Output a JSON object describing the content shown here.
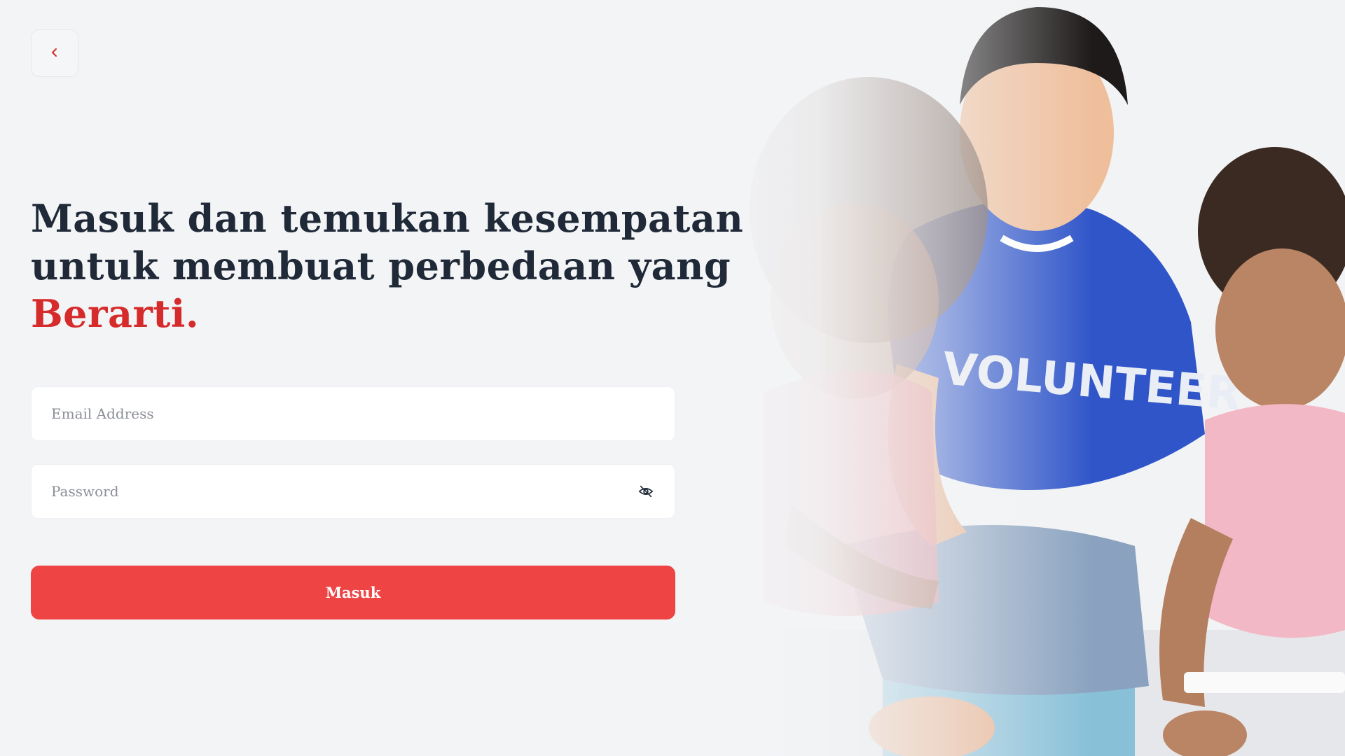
{
  "headline": {
    "line1": "Masuk dan temukan kesempatan",
    "line2": "untuk membuat perbedaan yang",
    "accent": "Berarti."
  },
  "form": {
    "email_placeholder": "Email Address",
    "password_placeholder": "Password",
    "submit_label": "Masuk"
  },
  "hero": {
    "shirt_text": "VOLUNTEER"
  },
  "icons": {
    "back": "chevron-left-icon",
    "password_toggle": "eye-off-icon"
  },
  "colors": {
    "accent": "#d62b2b",
    "button": "#ef4444",
    "heading": "#1f2937",
    "background": "#f3f4f6"
  }
}
